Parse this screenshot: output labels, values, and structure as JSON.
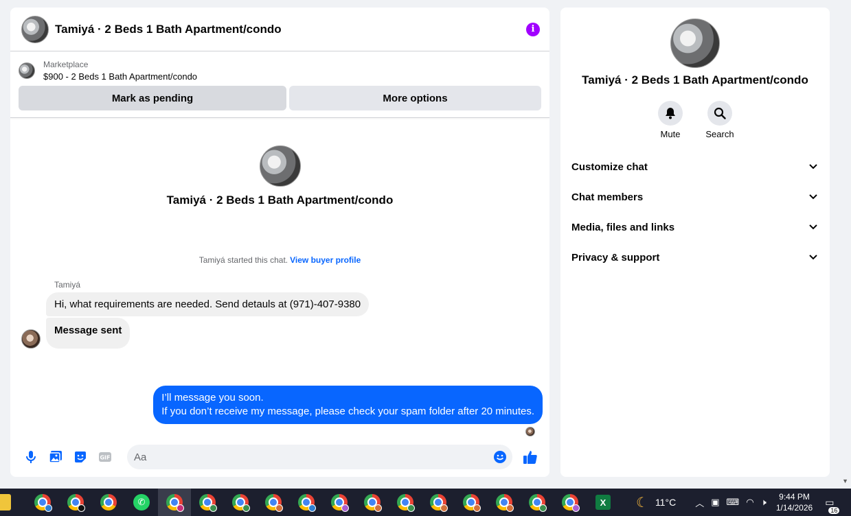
{
  "chat": {
    "title": "Tamiyá · 2 Beds 1 Bath Apartment/condo",
    "marketplace_label": "Marketplace",
    "listing": "$900 - 2 Beds 1 Bath Apartment/condo",
    "mark_pending_label": "Mark as pending",
    "more_options_label": "More options",
    "intro_name": "Tamiyá · 2 Beds 1 Bath Apartment/condo",
    "started_text": "Tamiyá started this chat.",
    "view_profile_label": "View buyer profile",
    "sender_name": "Tamiyá",
    "messages_in": [
      "Hi, what requirements are needed. Send detauls at (971)-407-9380",
      "Message sent"
    ],
    "message_out_line1": "I’ll message you soon.",
    "message_out_line2": "If you don’t receive my message, please check your spam folder after 20 minutes.",
    "composer_placeholder": "Aa",
    "gif_label": "GIF"
  },
  "side": {
    "name": "Tamiyá · 2 Beds 1 Bath Apartment/condo",
    "mute_label": "Mute",
    "search_label": "Search",
    "menu": [
      "Customize chat",
      "Chat members",
      "Media, files and links",
      "Privacy & support"
    ]
  },
  "taskbar": {
    "weather": "11°C",
    "time": "9:44 PM",
    "date": "1/14/2026",
    "notification_count": "16",
    "excel_letter": "X",
    "badge_colors": [
      "#c9307a",
      "#3b8f4e",
      "#3b8f4e",
      "#d2703a",
      "#2f7fd1",
      "#a85fd1",
      "#d2703a",
      "#3b8f4e",
      "#d2703a",
      "#d2703a",
      "#d2703a",
      "#3b8f4e",
      "#a85fd1"
    ]
  },
  "colors": {
    "accent": "#0866ff",
    "info": "#a100ff",
    "taskbar": "#1c1f2e"
  }
}
